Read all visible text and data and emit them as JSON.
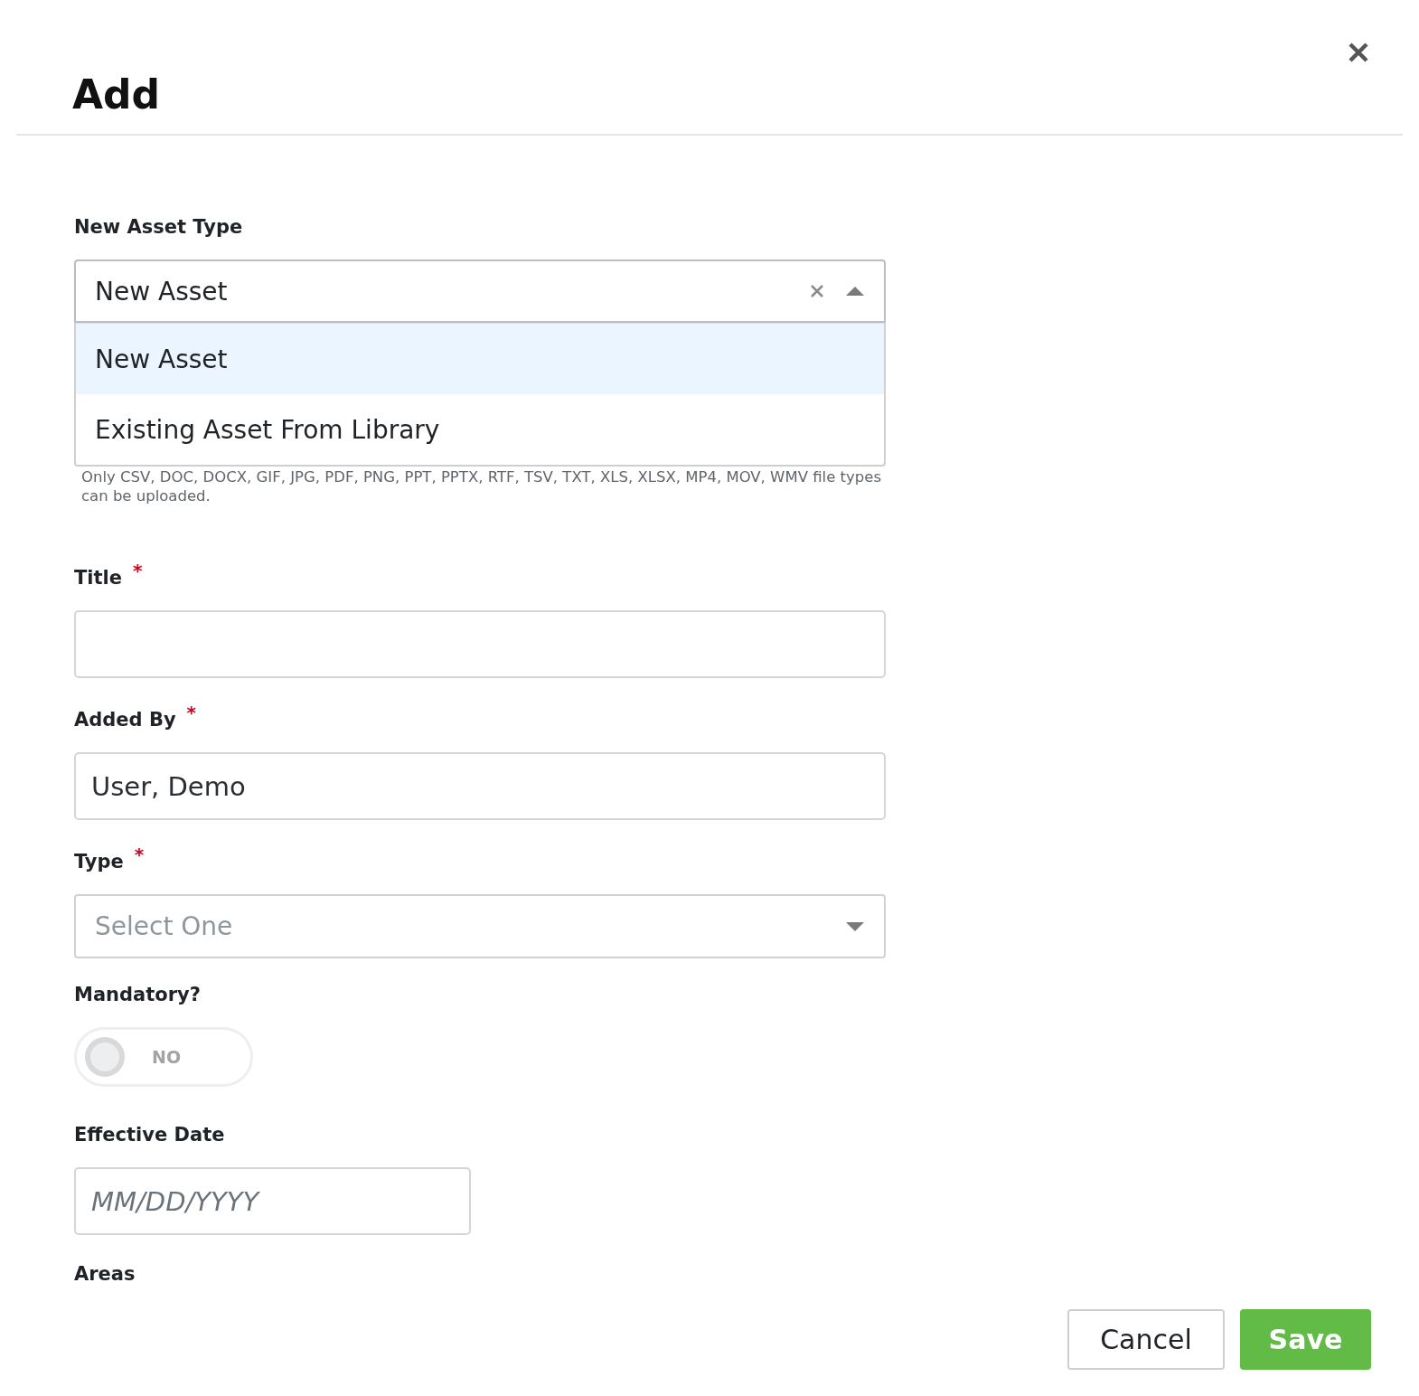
{
  "dialog": {
    "title": "Add"
  },
  "asset_type": {
    "label": "New Asset Type",
    "value": "New Asset",
    "expanded": true,
    "options": [
      {
        "label": "New Asset",
        "selected": true
      },
      {
        "label": "Existing Asset From Library",
        "selected": false
      }
    ],
    "help_text": "Only CSV, DOC, DOCX, GIF, JPG, PDF, PNG, PPT, PPTX, RTF, TSV, TXT, XLS, XLSX, MP4, MOV, WMV file types can be uploaded."
  },
  "fields": [
    {
      "kind": "text",
      "label": "Title",
      "required_mark": "*"
    },
    {
      "kind": "text",
      "label": "Added By",
      "required_mark": "*",
      "value": "User, Demo"
    },
    {
      "kind": "select",
      "label": "Type",
      "required_mark": "*",
      "placeholder": "Select One"
    },
    {
      "kind": "toggle",
      "label": "Mandatory?",
      "on": false,
      "state_text": "NO"
    },
    {
      "kind": "date",
      "label": "Effective Date",
      "placeholder": "MM/DD/YYYY"
    },
    {
      "kind": "heading",
      "label": "Areas"
    }
  ],
  "buttons": [
    {
      "kind": "secondary",
      "label": "Cancel"
    },
    {
      "kind": "primary",
      "label": "Save"
    }
  ]
}
